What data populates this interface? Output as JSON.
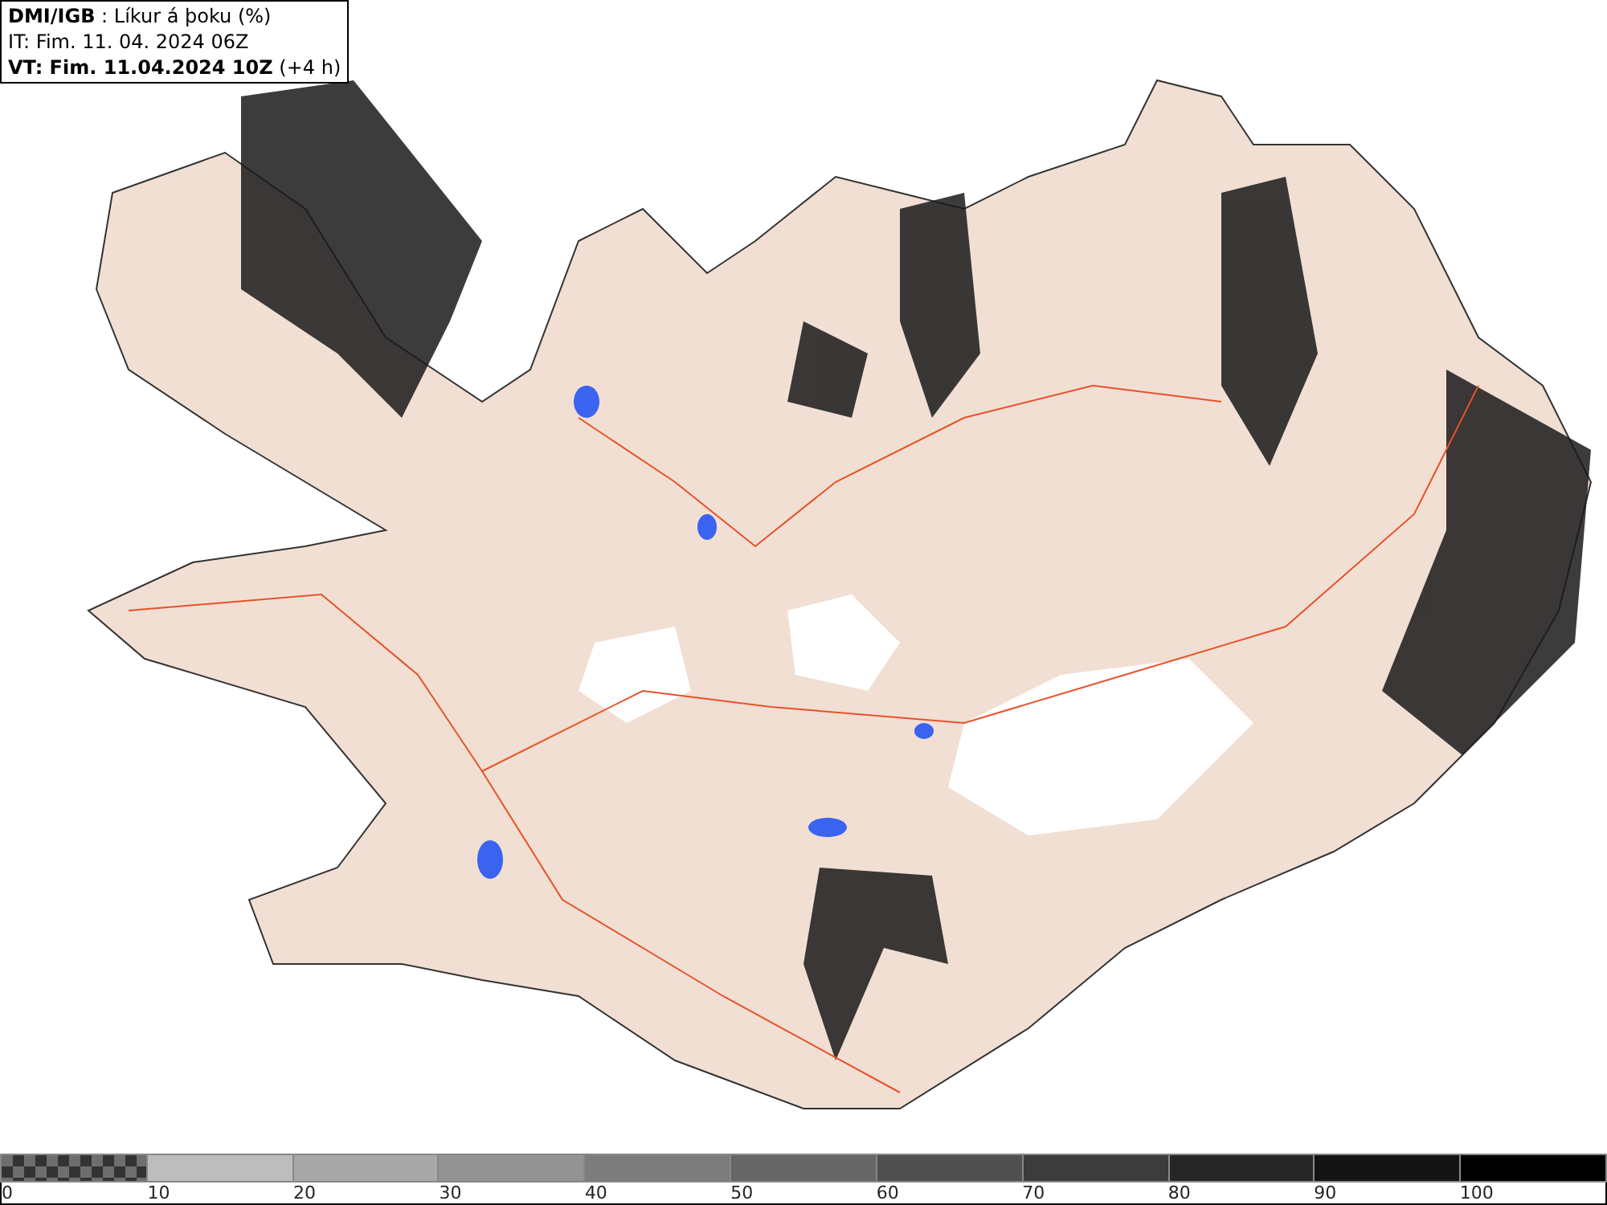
{
  "header": {
    "lines": [
      "**DMI/IGB** : Líkur á þoku (%)",
      "IT: Fim. 11. 04. 2024 06Z",
      "**VT: Fim. 11.04.2024 10Z** (+4 h)"
    ]
  },
  "legend": {
    "segments": [
      {
        "kind": "checker",
        "color": "#6e6e6e"
      },
      {
        "kind": "solid",
        "color": "#bdbdbd"
      },
      {
        "kind": "solid",
        "color": "#a8a8a8"
      },
      {
        "kind": "solid",
        "color": "#939393"
      },
      {
        "kind": "solid",
        "color": "#7c7c7c"
      },
      {
        "kind": "solid",
        "color": "#666666"
      },
      {
        "kind": "solid",
        "color": "#505050"
      },
      {
        "kind": "solid",
        "color": "#3c3c3c"
      },
      {
        "kind": "solid",
        "color": "#262626"
      },
      {
        "kind": "solid",
        "color": "#141414"
      },
      {
        "kind": "solid",
        "color": "#000000"
      }
    ],
    "labels": [
      "0",
      "10",
      "20",
      "30",
      "40",
      "50",
      "60",
      "70",
      "80",
      "90",
      "100"
    ]
  }
}
